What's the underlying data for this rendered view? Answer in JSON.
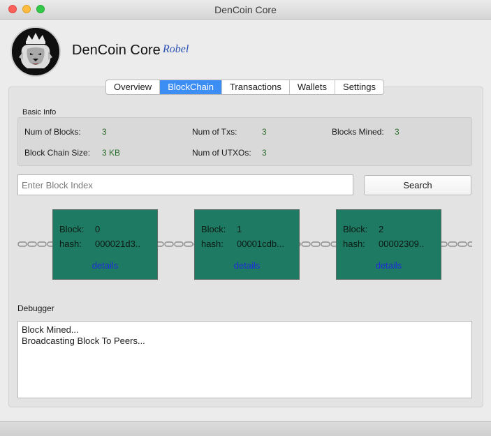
{
  "window": {
    "title": "DenCoin Core"
  },
  "header": {
    "app_name": "DenCoin Core",
    "user": "Robel",
    "logo_icon": "lion-crown-icon"
  },
  "tabs": [
    {
      "label": "Overview",
      "active": false
    },
    {
      "label": "BlockChain",
      "active": true
    },
    {
      "label": "Transactions",
      "active": false
    },
    {
      "label": "Wallets",
      "active": false
    },
    {
      "label": "Settings",
      "active": false
    }
  ],
  "basic_info": {
    "title": "Basic Info",
    "num_blocks_label": "Num of Blocks:",
    "num_blocks": "3",
    "num_txs_label": "Num of Txs:",
    "num_txs": "3",
    "blocks_mined_label": "Blocks Mined:",
    "blocks_mined": "3",
    "chain_size_label": "Block Chain Size:",
    "chain_size": "3 KB",
    "num_utxos_label": "Num of UTXOs:",
    "num_utxos": "3"
  },
  "search": {
    "placeholder": "Enter Block Index",
    "value": "",
    "button_label": "Search"
  },
  "blocks": [
    {
      "block_label": "Block:",
      "index": "0",
      "hash_label": "hash:",
      "hash": "000021d3..",
      "details_label": "details"
    },
    {
      "block_label": "Block:",
      "index": "1",
      "hash_label": "hash:",
      "hash": "00001cdb...",
      "details_label": "details"
    },
    {
      "block_label": "Block:",
      "index": "2",
      "hash_label": "hash:",
      "hash": "00002309..",
      "details_label": "details"
    }
  ],
  "debugger": {
    "title": "Debugger",
    "lines": [
      "Block Mined...",
      "Broadcasting Block To Peers..."
    ]
  },
  "colors": {
    "block_fill": "#1e7a62",
    "active_tab": "#3c8ef5",
    "value_green": "#2c6e2c",
    "details_link": "#1d2dd8"
  }
}
